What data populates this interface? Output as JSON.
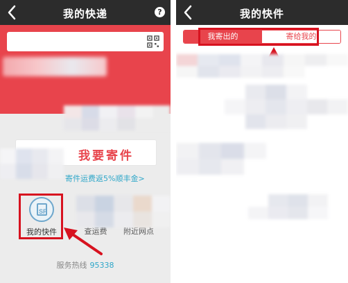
{
  "left_screen": {
    "title": "我的快递",
    "help_icon_char": "?",
    "send_button_label": "我要寄件",
    "promo_text": "寄件运费返5%顺丰金>",
    "my_parcels_label": "我的快件",
    "sf_badge": "SF",
    "service_tile_2_label": "查运费",
    "service_tile_3_label": "附近网点",
    "hotline_label": "服务热线",
    "hotline_number": "95338"
  },
  "right_screen": {
    "title": "我的快件",
    "tabs": [
      {
        "label": "我寄出的",
        "active": true
      },
      {
        "label": "寄给我的",
        "active": false
      }
    ]
  },
  "colors": {
    "topbar": "#2c2c2c",
    "brand_red": "#e8444c",
    "annotation_red": "#d7121f",
    "link_blue": "#2fa7c9"
  }
}
